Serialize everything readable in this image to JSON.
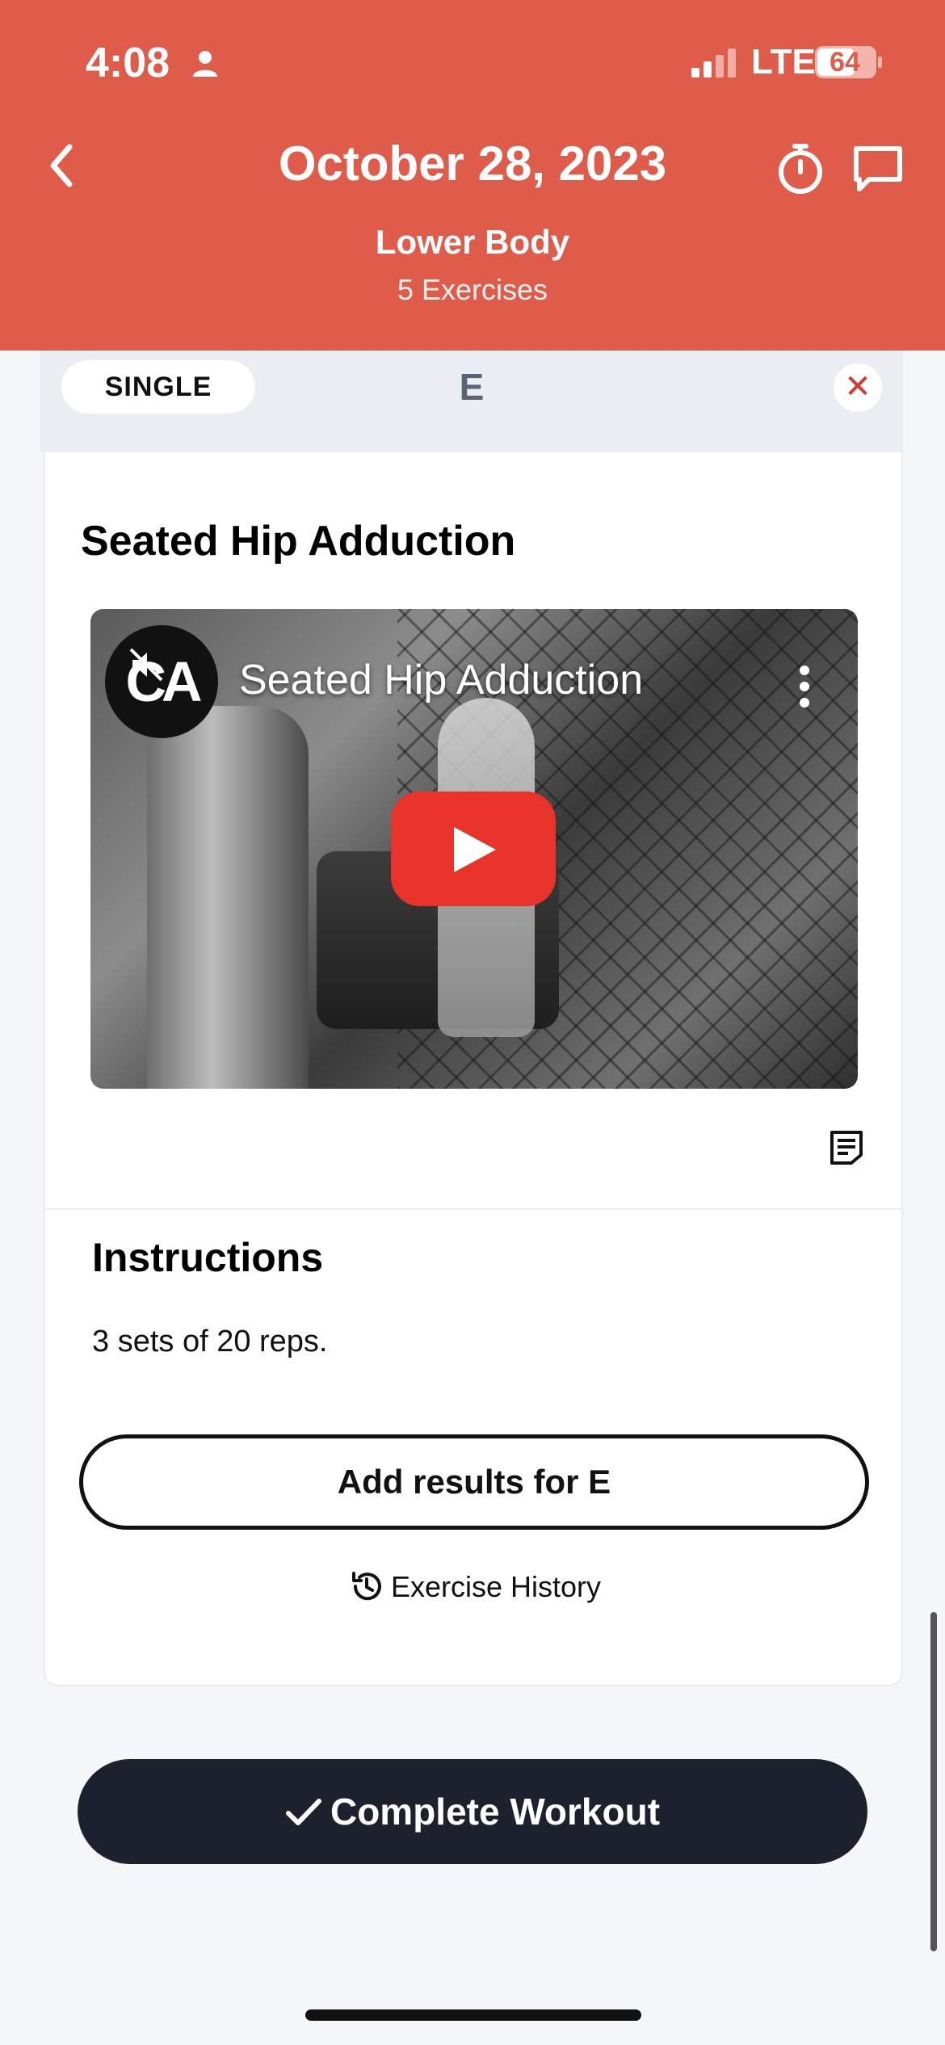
{
  "status_bar": {
    "time": "4:08",
    "network": "LTE",
    "battery": "64"
  },
  "header": {
    "title": "October 28, 2023",
    "workout_name": "Lower Body",
    "exercise_count": "5 Exercises"
  },
  "section": {
    "type_label": "SINGLE",
    "letter": "E",
    "close_symbol": "✕"
  },
  "exercise": {
    "title": "Seated Hip Adduction",
    "video_title": "Seated Hip Adduction",
    "channel_logo_text": "CA",
    "instructions_heading": "Instructions",
    "instructions_text": "3 sets of 20 reps.",
    "add_results_label": "Add results for E",
    "history_label": "Exercise History"
  },
  "footer": {
    "complete_label": "Complete Workout"
  },
  "colors": {
    "header_bg": "#e05c4a",
    "play_button": "#e8332a",
    "complete_button_bg": "#1c212d",
    "close_x": "#d9382e"
  }
}
